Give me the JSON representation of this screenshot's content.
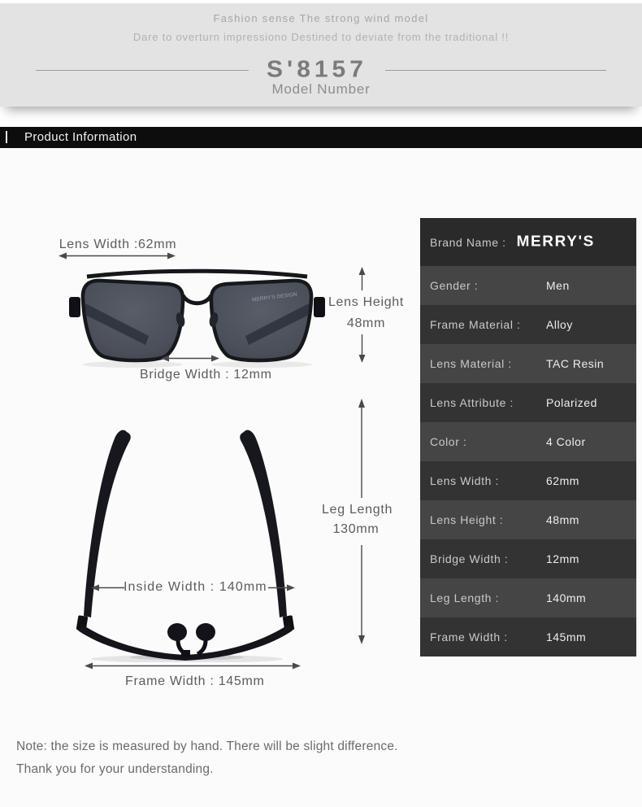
{
  "banner": {
    "tagline1": "Fashion sense The strong wind model",
    "tagline2": "Dare to overturn impressiono Destined to deviate from the traditional !!",
    "model_code": "S'8157",
    "model_label": "Model Number"
  },
  "section": {
    "title": "Product Information"
  },
  "diagram": {
    "front": {
      "lens_width": "Lens Width :62mm",
      "lens_height_label": "Lens Height",
      "lens_height_value": "48mm",
      "bridge_width": "Bridge Width : 12mm",
      "lens_print": "MERRY'S DESIGN"
    },
    "top": {
      "inside_width": "Inside Width : 140mm",
      "leg_length_label": "Leg Length",
      "leg_length_value": "130mm",
      "frame_width": "Frame Width : 145mm"
    }
  },
  "specs": {
    "brand_label": "Brand Name :",
    "brand_value": "MERRY'S",
    "rows": [
      {
        "label": "Gender :",
        "value": "Men"
      },
      {
        "label": "Frame Material :",
        "value": "Alloy"
      },
      {
        "label": "Lens Material :",
        "value": "TAC Resin"
      },
      {
        "label": "Lens Attribute :",
        "value": "Polarized"
      },
      {
        "label": "Color :",
        "value": "4 Color"
      },
      {
        "label": "Lens Width :",
        "value": "62mm"
      },
      {
        "label": "Lens Height :",
        "value": "48mm"
      },
      {
        "label": "Bridge Width :",
        "value": "12mm"
      },
      {
        "label": "Leg Length :",
        "value": "140mm"
      },
      {
        "label": "Frame Width :",
        "value": "145mm"
      }
    ]
  },
  "note": {
    "line1": "Note: the size is measured by hand. There will be slight difference.",
    "line2": "Thank you for your understanding."
  },
  "colors": {
    "banner_bg": "#e3e3e3",
    "section_bar_bg": "#0d0d0d",
    "table_brand_row": "#2a2a2a",
    "table_row_light": "#454545",
    "table_row_dark": "#333333",
    "annotation_text": "#5c5c5c",
    "lens_tint": "#4d525c"
  }
}
